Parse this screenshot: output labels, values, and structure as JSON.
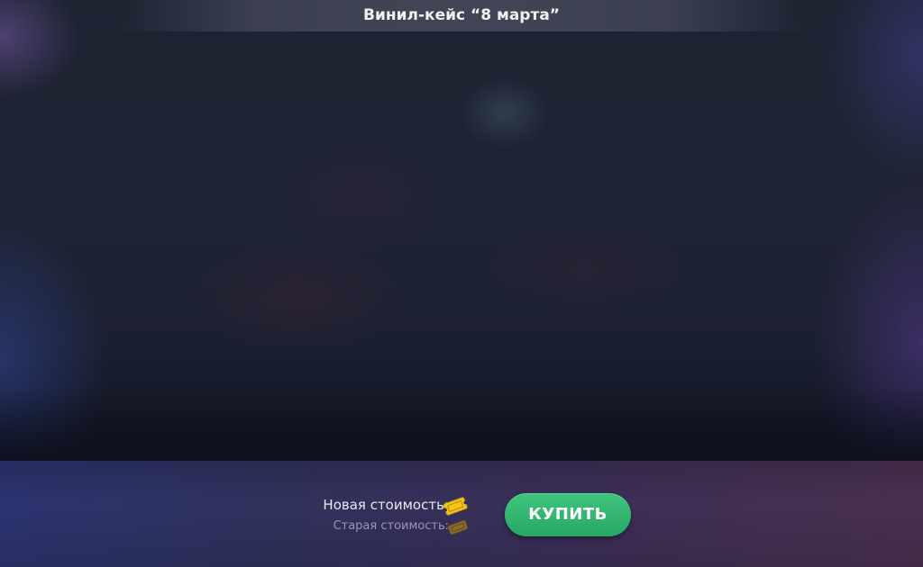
{
  "dialog": {
    "title": "Винил-кейс “8 марта”"
  },
  "pricing": {
    "new_price_label": "Новая стоимость:",
    "old_price_label": "Старая стоимость:",
    "currency_icon": "ticket-icon",
    "new_ticket_color": "#f5c518",
    "old_ticket_color": "#9a7a2a"
  },
  "actions": {
    "buy_label": "КУПИТЬ",
    "buy_color": "#33b872"
  }
}
